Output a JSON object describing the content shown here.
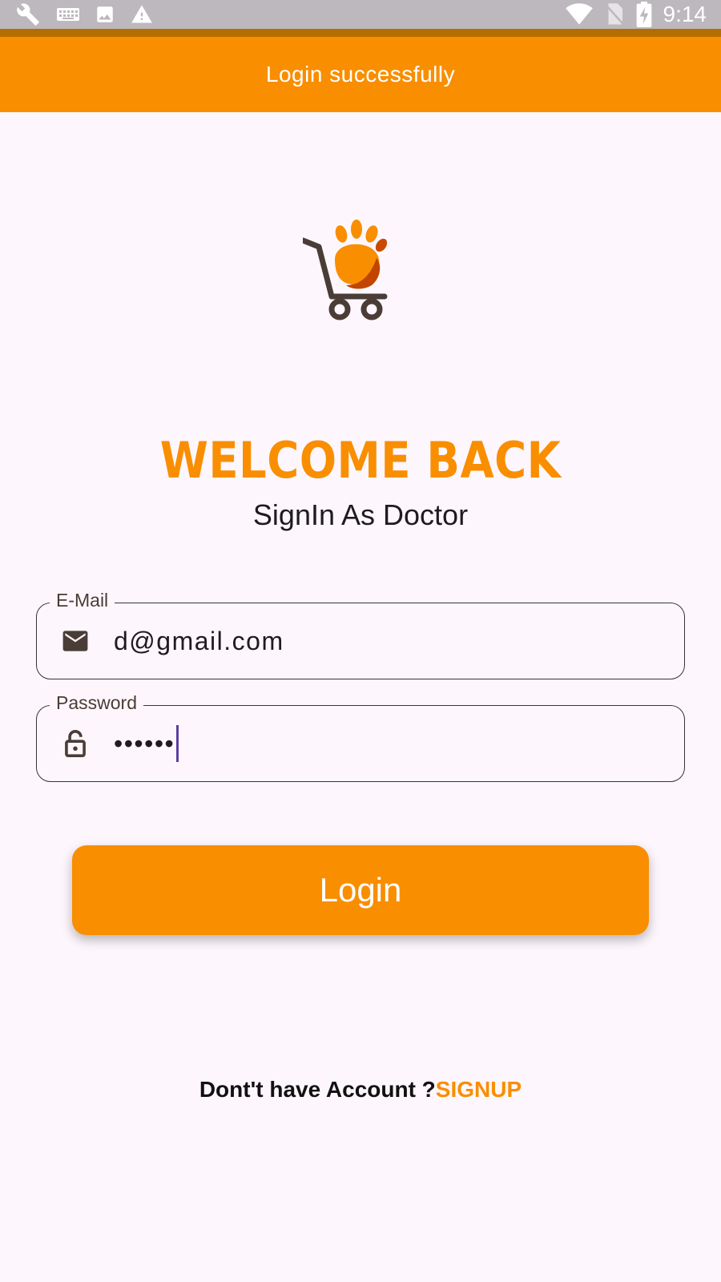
{
  "status_bar": {
    "time": "9:14",
    "left_icons": [
      "wrench-icon",
      "keyboard-icon",
      "image-icon",
      "warning-icon"
    ],
    "right_icons": [
      "wifi-icon",
      "no-sim-icon",
      "battery-charging-icon"
    ]
  },
  "app_bar": {
    "title": "Login successfully",
    "color": "#f98e00"
  },
  "logo": {
    "icon": "pet-shop-cart-logo"
  },
  "header": {
    "title": "WELCOME BACK",
    "subtitle": "SignIn As Doctor"
  },
  "form": {
    "email": {
      "label": "E-Mail",
      "value": "d@gmail.com",
      "icon": "mail-icon"
    },
    "password": {
      "label": "Password",
      "value": "••••••",
      "icon": "lock-icon"
    },
    "submit_label": "Login"
  },
  "footer": {
    "prompt": "Dont't have Account ?",
    "link_label": "SIGNUP"
  },
  "colors": {
    "accent": "#f98e00",
    "background": "#fdf7fd",
    "text": "#1f1b20"
  }
}
